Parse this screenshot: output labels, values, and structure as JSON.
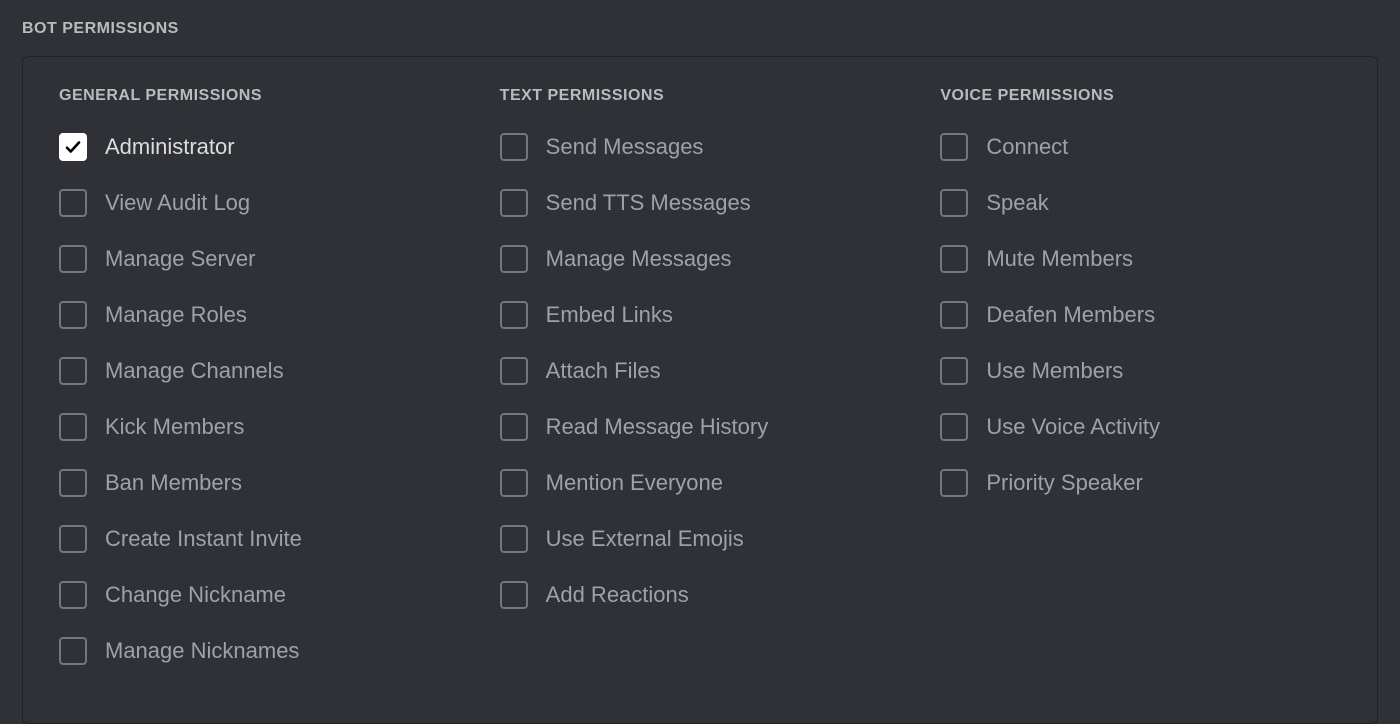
{
  "section_title": "BOT PERMISSIONS",
  "columns": [
    {
      "title": "GENERAL PERMISSIONS",
      "items": [
        {
          "label": "Administrator",
          "checked": true
        },
        {
          "label": "View Audit Log",
          "checked": false
        },
        {
          "label": "Manage Server",
          "checked": false
        },
        {
          "label": "Manage Roles",
          "checked": false
        },
        {
          "label": "Manage Channels",
          "checked": false
        },
        {
          "label": "Kick Members",
          "checked": false
        },
        {
          "label": "Ban Members",
          "checked": false
        },
        {
          "label": "Create Instant Invite",
          "checked": false
        },
        {
          "label": "Change Nickname",
          "checked": false
        },
        {
          "label": "Manage Nicknames",
          "checked": false
        }
      ]
    },
    {
      "title": "TEXT PERMISSIONS",
      "items": [
        {
          "label": "Send Messages",
          "checked": false
        },
        {
          "label": "Send TTS Messages",
          "checked": false
        },
        {
          "label": "Manage Messages",
          "checked": false
        },
        {
          "label": "Embed Links",
          "checked": false
        },
        {
          "label": "Attach Files",
          "checked": false
        },
        {
          "label": "Read Message History",
          "checked": false
        },
        {
          "label": "Mention Everyone",
          "checked": false
        },
        {
          "label": "Use External Emojis",
          "checked": false
        },
        {
          "label": "Add Reactions",
          "checked": false
        }
      ]
    },
    {
      "title": "VOICE PERMISSIONS",
      "items": [
        {
          "label": "Connect",
          "checked": false
        },
        {
          "label": "Speak",
          "checked": false
        },
        {
          "label": "Mute Members",
          "checked": false
        },
        {
          "label": "Deafen Members",
          "checked": false
        },
        {
          "label": "Use Members",
          "checked": false
        },
        {
          "label": "Use Voice Activity",
          "checked": false
        },
        {
          "label": "Priority Speaker",
          "checked": false
        }
      ]
    }
  ]
}
